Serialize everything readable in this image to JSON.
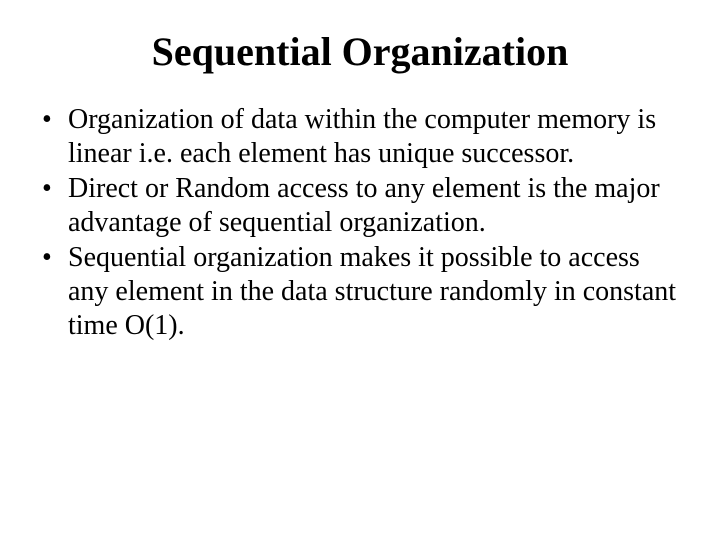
{
  "title": "Sequential Organization",
  "bullets": [
    "Organization of data within the computer memory is linear i.e. each element has unique successor.",
    "Direct or Random access to any element is the major advantage of sequential organization.",
    "Sequential organization makes it possible to access any element in the data structure randomly in constant time O(1)."
  ]
}
